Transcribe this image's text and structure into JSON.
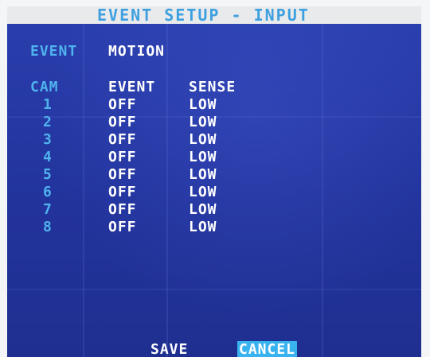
{
  "header": {
    "title": "EVENT SETUP - INPUT"
  },
  "event": {
    "label": "EVENT",
    "value": "MOTION"
  },
  "table": {
    "headers": {
      "cam": "CAM",
      "event": "EVENT",
      "sense": "SENSE"
    },
    "rows": [
      {
        "cam": "1",
        "event": "OFF",
        "sense": "LOW"
      },
      {
        "cam": "2",
        "event": "OFF",
        "sense": "LOW"
      },
      {
        "cam": "3",
        "event": "OFF",
        "sense": "LOW"
      },
      {
        "cam": "4",
        "event": "OFF",
        "sense": "LOW"
      },
      {
        "cam": "5",
        "event": "OFF",
        "sense": "LOW"
      },
      {
        "cam": "6",
        "event": "OFF",
        "sense": "LOW"
      },
      {
        "cam": "7",
        "event": "OFF",
        "sense": "LOW"
      },
      {
        "cam": "8",
        "event": "OFF",
        "sense": "LOW"
      }
    ]
  },
  "buttons": {
    "save": "SAVE",
    "cancel": "CANCEL",
    "selected": "cancel"
  },
  "colors": {
    "background": "#23359e",
    "label_cyan": "#4fb3ee",
    "value_white": "#ffffff",
    "highlight": "#39b2f0",
    "title_bar": "#e9eaec"
  }
}
